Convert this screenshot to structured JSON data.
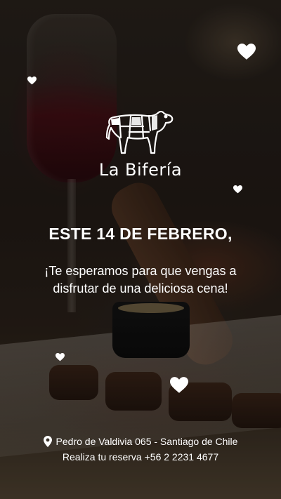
{
  "brand": {
    "name": "La Bifería",
    "logo_icon": "cow-cuts-icon"
  },
  "headline": "ESTE 14 DE FEBRERO,",
  "message": "¡Te esperamos para que vengas a disfrutar de una deliciosa cena!",
  "footer": {
    "address_icon": "location-pin-icon",
    "address": "Pedro de Valdivia 065 - Santiago de Chile",
    "reservation": "Realiza tu reserva +56 2 2231 4677"
  },
  "decorations": {
    "icon": "heart-icon",
    "color": "#ffffff"
  }
}
